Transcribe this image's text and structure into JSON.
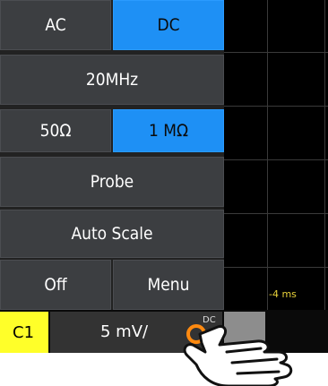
{
  "menu": {
    "ac_label": "AC",
    "dc_label": "DC",
    "bandwidth_label": "20MHz",
    "imp50_label": "50Ω",
    "imp1m_label": "1 MΩ",
    "probe_label": "Probe",
    "autoscale_label": "Auto Scale",
    "off_label": "Off",
    "menu_label": "Menu"
  },
  "waveform": {
    "time_label": "-4 ms"
  },
  "statusbar": {
    "channel_label": "C1",
    "scale_value": "5 mV/",
    "coupling_label": "DC"
  },
  "colors": {
    "active": "#1e90f5",
    "channel": "#ffff29",
    "knob": "#ff8a10"
  },
  "icons": [
    "rotary-knob-icon",
    "pointing-hand-icon"
  ]
}
